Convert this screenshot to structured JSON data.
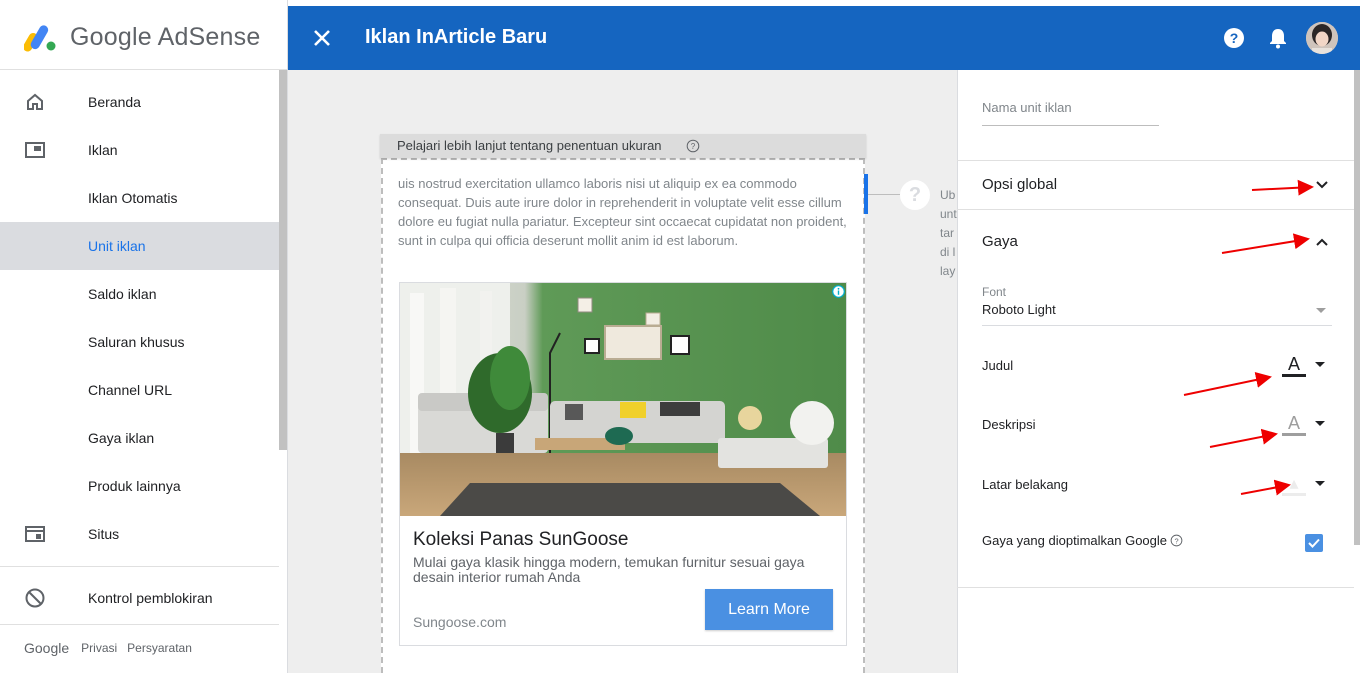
{
  "app": {
    "logo_text": "Google AdSense"
  },
  "header": {
    "title": "Iklan InArticle Baru"
  },
  "sidebar": {
    "items": [
      {
        "label": "Beranda",
        "icon": "home-icon"
      },
      {
        "label": "Iklan",
        "icon": "ads-icon"
      },
      {
        "label": "Iklan Otomatis"
      },
      {
        "label": "Unit iklan",
        "active": true
      },
      {
        "label": "Saldo iklan"
      },
      {
        "label": "Saluran khusus"
      },
      {
        "label": "Channel URL"
      },
      {
        "label": "Gaya iklan"
      },
      {
        "label": "Produk lainnya"
      },
      {
        "label": "Situs",
        "icon": "sites-icon"
      },
      {
        "label": "Kontrol pemblokiran",
        "icon": "block-icon"
      }
    ],
    "footer": {
      "google": "Google",
      "privacy": "Privasi",
      "terms": "Persyaratan"
    }
  },
  "preview": {
    "size_hint": "Pelajari lebih lanjut tentang penentuan ukuran",
    "lorem": "uis nostrud exercitation ullamco laboris nisi ut aliquip ex ea commodo consequat. Duis aute irure dolor in reprehenderit in voluptate velit esse cillum dolore eu fugiat nulla pariatur. Excepteur sint occaecat cupidatat non proident, sunt in culpa qui officia deserunt mollit anim id est laborum.",
    "ad": {
      "title": "Koleksi Panas SunGoose",
      "description": "Mulai gaya klasik hingga modern, temukan furnitur sesuai gaya desain interior rumah Anda",
      "domain": "Sungoose.com",
      "cta": "Learn More"
    },
    "tip_lines": [
      "Ub",
      "unt",
      "tar",
      "di l",
      "lay"
    ]
  },
  "panel": {
    "name_placeholder": "Nama unit iklan",
    "global_options": "Opsi global",
    "style_section": "Gaya",
    "font_label": "Font",
    "font_value": "Roboto Light",
    "title_label": "Judul",
    "description_label": "Deskripsi",
    "background_label": "Latar belakang",
    "google_optimized": "Gaya yang dioptimalkan Google",
    "google_optimized_checked": true,
    "colors": {
      "title": "#202124",
      "description": "#9e9e9e",
      "background": "#ececec",
      "accent": "#1565c0",
      "cta": "#4a90e2"
    }
  }
}
